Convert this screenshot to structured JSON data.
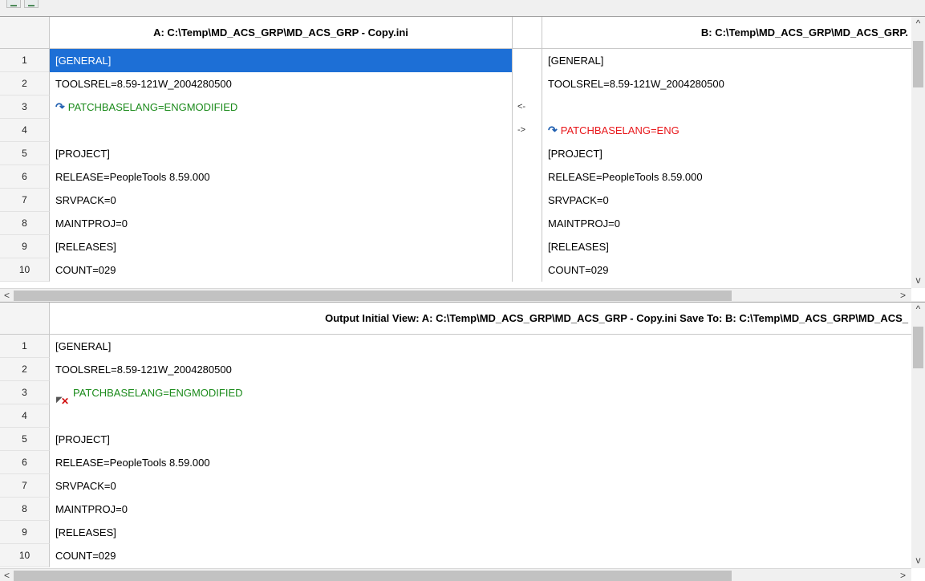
{
  "left": {
    "title": "A: C:\\Temp\\MD_ACS_GRP\\MD_ACS_GRP - Copy.ini",
    "lines": [
      {
        "n": "1",
        "t": "[GENERAL]"
      },
      {
        "n": "2",
        "t": "TOOLSREL=8.59-121W_2004280500"
      },
      {
        "n": "3",
        "t": "PATCHBASELANG=ENGMODIFIED"
      },
      {
        "n": "4",
        "t": ""
      },
      {
        "n": "5",
        "t": "[PROJECT]"
      },
      {
        "n": "6",
        "t": "RELEASE=PeopleTools 8.59.000"
      },
      {
        "n": "7",
        "t": "SRVPACK=0"
      },
      {
        "n": "8",
        "t": "MAINTPROJ=0"
      },
      {
        "n": "9",
        "t": "[RELEASES]"
      },
      {
        "n": "10",
        "t": "COUNT=029"
      }
    ]
  },
  "compare": {
    "copy_left": "<-",
    "copy_right": "->"
  },
  "right": {
    "title": "B: C:\\Temp\\MD_ACS_GRP\\MD_ACS_GRP.",
    "lines": [
      {
        "t": "[GENERAL]"
      },
      {
        "t": "TOOLSREL=8.59-121W_2004280500"
      },
      {
        "t": ""
      },
      {
        "t": "PATCHBASELANG=ENG"
      },
      {
        "t": "[PROJECT]"
      },
      {
        "t": "RELEASE=PeopleTools 8.59.000"
      },
      {
        "t": "SRVPACK=0"
      },
      {
        "t": "MAINTPROJ=0"
      },
      {
        "t": "[RELEASES]"
      },
      {
        "t": "COUNT=029"
      }
    ]
  },
  "output": {
    "title": "Output   Initial View: A: C:\\Temp\\MD_ACS_GRP\\MD_ACS_GRP - Copy.ini   Save To: B: C:\\Temp\\MD_ACS_GRP\\MD_ACS_",
    "lines": [
      {
        "n": "1",
        "t": "[GENERAL]"
      },
      {
        "n": "2",
        "t": "TOOLSREL=8.59-121W_2004280500"
      },
      {
        "n": "3",
        "t": "PATCHBASELANG=ENGMODIFIED"
      },
      {
        "n": "4",
        "t": ""
      },
      {
        "n": "5",
        "t": "[PROJECT]"
      },
      {
        "n": "6",
        "t": "RELEASE=PeopleTools 8.59.000"
      },
      {
        "n": "7",
        "t": "SRVPACK=0"
      },
      {
        "n": "8",
        "t": "MAINTPROJ=0"
      },
      {
        "n": "9",
        "t": "[RELEASES]"
      },
      {
        "n": "10",
        "t": "COUNT=029"
      }
    ]
  },
  "scroll": {
    "up": "^",
    "down": "v",
    "left": "<",
    "right": ">"
  },
  "icons": {
    "change_marker": "curved-arrow-icon",
    "reject_marker": "rejected-change-icon"
  },
  "colors": {
    "selection": "#1d6fd6",
    "added": "#1a8a1a",
    "removed": "#e8171b"
  }
}
